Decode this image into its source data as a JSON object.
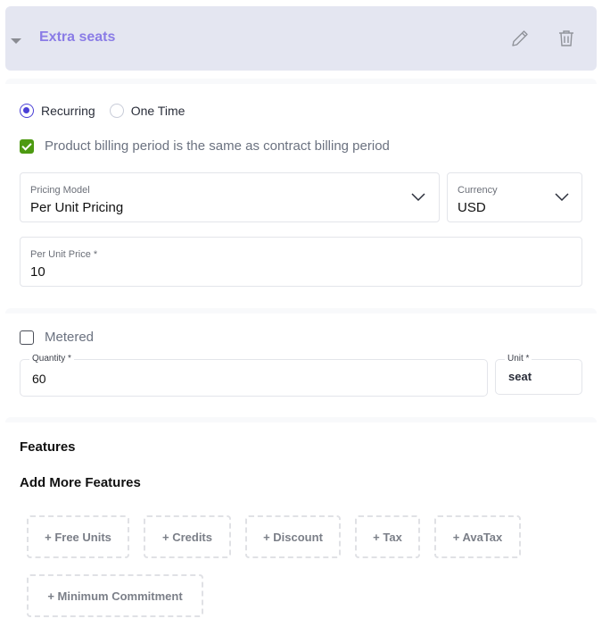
{
  "header": {
    "title": "Extra seats",
    "toggle_icon": "caret-down-icon",
    "edit_icon": "pencil-icon",
    "delete_icon": "trash-icon"
  },
  "billing_type": {
    "options": [
      {
        "label": "Recurring",
        "selected": true
      },
      {
        "label": "One Time",
        "selected": false
      }
    ]
  },
  "same_period": {
    "label": "Product billing period is the same as contract billing period",
    "checked": true
  },
  "pricing_model": {
    "label": "Pricing Model",
    "value": "Per Unit Pricing"
  },
  "currency": {
    "label": "Currency",
    "value": "USD"
  },
  "per_unit_price": {
    "label": "Per Unit Price *",
    "value": "10"
  },
  "metered": {
    "label": "Metered",
    "checked": false
  },
  "quantity": {
    "label": "Quantity *",
    "value": "60"
  },
  "unit": {
    "label": "Unit *",
    "value": "seat"
  },
  "features": {
    "title": "Features",
    "add_more_title": "Add More Features",
    "chips": [
      "+ Free Units",
      "+ Credits",
      "+ Discount",
      "+ Tax",
      "+ AvaTax",
      "+ Minimum Commitment"
    ]
  },
  "colors": {
    "accent": "#4a3fd6",
    "title": "#8a7ce6",
    "check": "#4d9a11",
    "header_bg": "#e4e6f1"
  }
}
